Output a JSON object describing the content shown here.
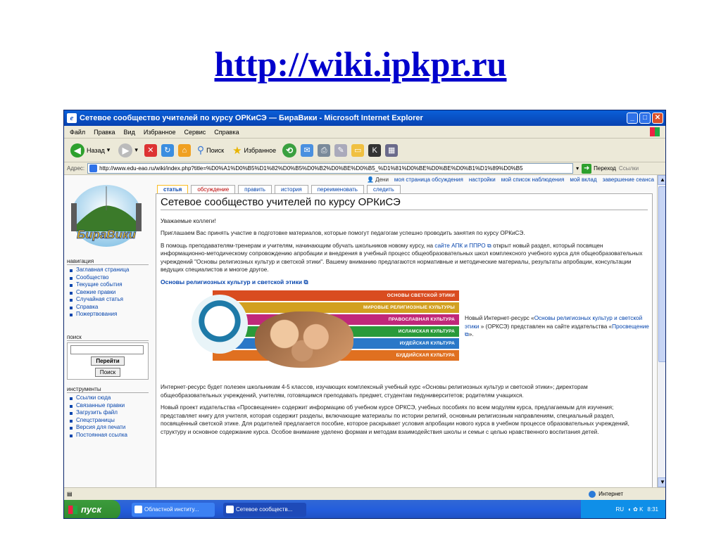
{
  "slide": {
    "title": "http://wiki.ipkpr.ru"
  },
  "window": {
    "title": "Сетевое сообщество учителей по курсу ОРКиСЭ — БираВики - Microsoft Internet Explorer",
    "menu": [
      "Файл",
      "Правка",
      "Вид",
      "Избранное",
      "Сервис",
      "Справка"
    ]
  },
  "toolbar": {
    "back": "Назад",
    "search": "Поиск",
    "favorites": "Избранное"
  },
  "address": {
    "label": "Адрес:",
    "url": "http://www.edu-eao.ru/wiki/index.php?title=%D0%A1%D0%B5%D1%82%D0%B5%D0%B2%D0%BE%D0%B5_%D1%81%D0%BE%D0%BE%D0%B1%D1%89%D0%B5",
    "go": "Переход",
    "links": "Ссылки"
  },
  "personal": {
    "user": "Дени",
    "items": [
      "моя страница обсуждения",
      "настройки",
      "мой список наблюдения",
      "мой вклад",
      "завершение сеанса"
    ]
  },
  "tabs": [
    "статья",
    "обсуждение",
    "править",
    "история",
    "переименовать",
    "следить"
  ],
  "sidebar": {
    "logo_text": "БираВики",
    "nav_head": "навигация",
    "nav": [
      "Заглавная страница",
      "Сообщество",
      "Текущие события",
      "Свежие правки",
      "Случайная статья",
      "Справка",
      "Пожертвования"
    ],
    "search_head": "поиск",
    "search_go": "Перейти",
    "search_btn": "Поиск",
    "tools_head": "инструменты",
    "tools": [
      "Ссылки сюда",
      "Связанные правки",
      "Загрузить файл",
      "Спецстраницы",
      "Версия для печати",
      "Постоянная ссылка"
    ]
  },
  "article": {
    "title": "Сетевое сообщество учителей по курсу ОРКиСЭ",
    "p1": "Уважаемые коллеги!",
    "p2": "Приглашаем Вас принять участие в подготовке материалов, которые помогут педагогам успешно проводить занятия по курсу ОРКиСЭ.",
    "p3a": "В помощь преподавателям-тренерам и учителям, начинающим обучать школьников новому курсу, на",
    "p3link": "сайте АПК и ППРО",
    "p3b": "открыт новый раздел, который посвящен информационно-методическому сопровождению апробации и внедрения в учебный процесс общеобразовательных школ комплексного учебного курса для общеобразовательных учреждений \"Основы религиозных культур и светской этики\". Вашему вниманию предлагаются нормативные и методические материалы, результаты апробации, консультации ведущих специалистов и многое другое.",
    "subhead": "Основы религиозных культур и светской этики",
    "banner_stripes": [
      "ОСНОВЫ СВЕТСКОЙ ЭТИКИ",
      "МИРОВЫЕ РЕЛИГИОЗНЫЕ КУЛЬТУРЫ",
      "ПРАВОСЛАВНАЯ КУЛЬТУРА",
      "ИСЛАМСКАЯ КУЛЬТУРА",
      "ИУДЕЙСКАЯ КУЛЬТУРА",
      "БУДДИЙСКАЯ КУЛЬТУРА"
    ],
    "side_a": "Новый Интернет-ресурс «",
    "side_link": "Основы религиозных культур и светской этики",
    "side_b": "» (ОРКСЭ) представлен на сайте издательства «",
    "side_link2": "Просвещение",
    "side_c": "».",
    "p4": "Интернет-ресурс будет полезен школьникам 4-5 классов, изучающих комплексный учебный курс «Основы религиозных культур и светской этики»; директорам общеобразовательных учреждений, учителям, готовящимся преподавать предмет, студентам педуниверситетов; родителям учащихся.",
    "p5": "Новый проект издательства «Просвещение» содержит информацию об учебном курсе ОРКСЭ, учебных пособиях по всем модулям курса, предлагаемым для изучения; представляет книгу для учителя, которая содержит разделы, включающие материалы по истории религий, основным религиозным направлениям, специальный раздел, посвящённый светской этике. Для родителей предлагается пособие, которое раскрывает условия апробации нового курса в учебном процессе образовательных учреждений, структуру и основное содержание курса. Особое внимание уделено формам и методам взаимодействия школы и семьи с целью нравственного воспитания детей."
  },
  "statusbar": {
    "zone": "Интернет"
  },
  "taskbar": {
    "start": "пуск",
    "tasks": [
      "Областной институ...",
      "Сетевое сообществ..."
    ],
    "lang": "RU",
    "time": "8:31"
  }
}
